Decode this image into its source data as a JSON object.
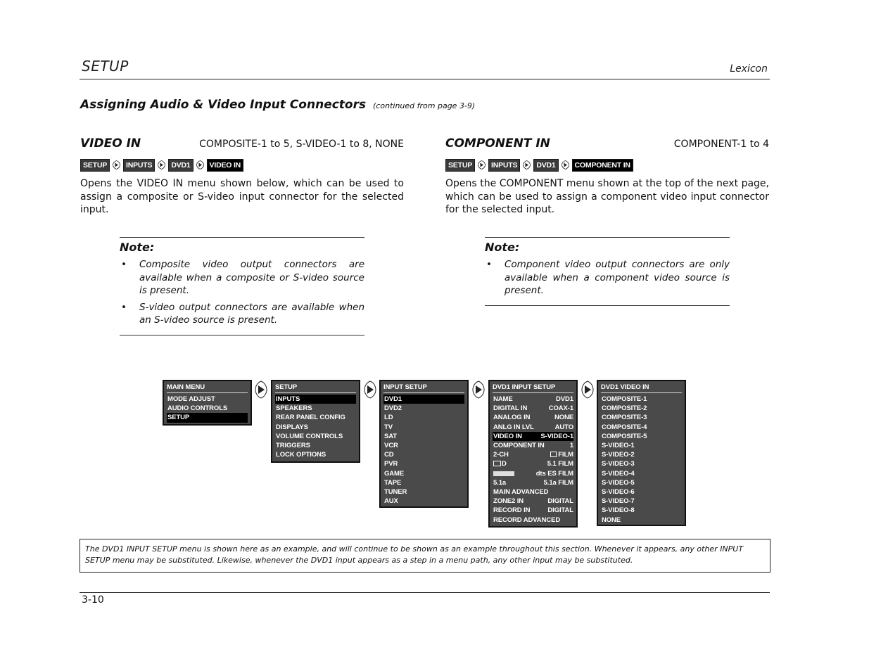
{
  "header": {
    "title": "SETUP",
    "brand": "Lexicon"
  },
  "section": {
    "heading": "Assigning Audio & Video Input Connectors",
    "continued": "(continued from page 3-9)"
  },
  "video_in": {
    "title": "VIDEO IN",
    "range": "COMPOSITE-1 to 5, S-VIDEO-1 to 8, NONE",
    "path": [
      "SETUP",
      "INPUTS",
      "DVD1",
      "VIDEO IN"
    ],
    "description": "Opens the VIDEO IN menu shown below, which can be used to assign a composite or S-video input connector for the selected input.",
    "note": {
      "title": "Note:",
      "items": [
        "Composite video output connectors are available when a composite or S-video source is present.",
        "S-video output connectors are available when an S-video source is present."
      ]
    }
  },
  "component_in": {
    "title": "COMPONENT IN",
    "range": "COMPONENT-1 to 4",
    "path": [
      "SETUP",
      "INPUTS",
      "DVD1",
      "COMPONENT IN"
    ],
    "description": "Opens the COMPONENT menu shown at the top of the next page, which can be used to assign a component video input connector for the selected input.",
    "note": {
      "title": "Note:",
      "items": [
        "Component video output connectors are only available when a component video source is present."
      ]
    }
  },
  "menus": {
    "main_menu": {
      "title": "MAIN MENU",
      "items": [
        "MODE ADJUST",
        "AUDIO CONTROLS",
        "SETUP"
      ],
      "selected": "SETUP"
    },
    "setup": {
      "title": "SETUP",
      "items": [
        "INPUTS",
        "SPEAKERS",
        "REAR PANEL CONFIG",
        "DISPLAYS",
        "VOLUME CONTROLS",
        "TRIGGERS",
        "LOCK OPTIONS"
      ],
      "selected": "INPUTS"
    },
    "input_setup": {
      "title": "INPUT SETUP",
      "items": [
        "DVD1",
        "DVD2",
        "LD",
        "TV",
        "SAT",
        "VCR",
        "CD",
        "PVR",
        "GAME",
        "TAPE",
        "TUNER",
        "AUX"
      ],
      "selected": "DVD1"
    },
    "dvd1_input_setup": {
      "title": "DVD1 INPUT SETUP",
      "rows": [
        {
          "label": "NAME",
          "value": "DVD1"
        },
        {
          "label": "DIGITAL IN",
          "value": "COAX-1"
        },
        {
          "label": "ANALOG IN",
          "value": "NONE"
        },
        {
          "label": "ANLG IN LVL",
          "value": "AUTO"
        },
        {
          "label": "VIDEO IN",
          "value": "S-VIDEO-1",
          "selected": true
        },
        {
          "label": "COMPONENT IN",
          "value": "1"
        },
        {
          "label": "2-CH",
          "value": "FILM",
          "icon": "film-icon"
        },
        {
          "label": "DD",
          "label_icon": "dolby-digital-icon",
          "value": "5.1 FILM",
          "icon": "film-icon"
        },
        {
          "label": "dts ES",
          "label_icon": "dts-es-icon",
          "value": "dts ES FILM",
          "icon": "film-icon"
        },
        {
          "label": "5.1a",
          "value": "5.1a FILM",
          "icon": "film-icon"
        },
        {
          "label": "MAIN ADVANCED",
          "value": ""
        },
        {
          "label": "ZONE2 IN",
          "value": "DIGITAL"
        },
        {
          "label": "RECORD IN",
          "value": "DIGITAL"
        },
        {
          "label": "RECORD ADVANCED",
          "value": ""
        }
      ]
    },
    "dvd1_video_in": {
      "title": "DVD1 VIDEO IN",
      "items": [
        "COMPOSITE-1",
        "COMPOSITE-2",
        "COMPOSITE-3",
        "COMPOSITE-4",
        "COMPOSITE-5",
        "S-VIDEO-1",
        "S-VIDEO-2",
        "S-VIDEO-3",
        "S-VIDEO-4",
        "S-VIDEO-5",
        "S-VIDEO-6",
        "S-VIDEO-7",
        "S-VIDEO-8",
        "NONE"
      ]
    }
  },
  "caption": "The DVD1 INPUT SETUP menu is shown here as an example, and will continue to be shown as an example throughout this section. Whenever it appears, any other INPUT SETUP menu may be substituted. Likewise, whenever the DVD1 input appears as a step in a menu path, any other input may be substituted.",
  "footer": {
    "page_number": "3-10"
  }
}
